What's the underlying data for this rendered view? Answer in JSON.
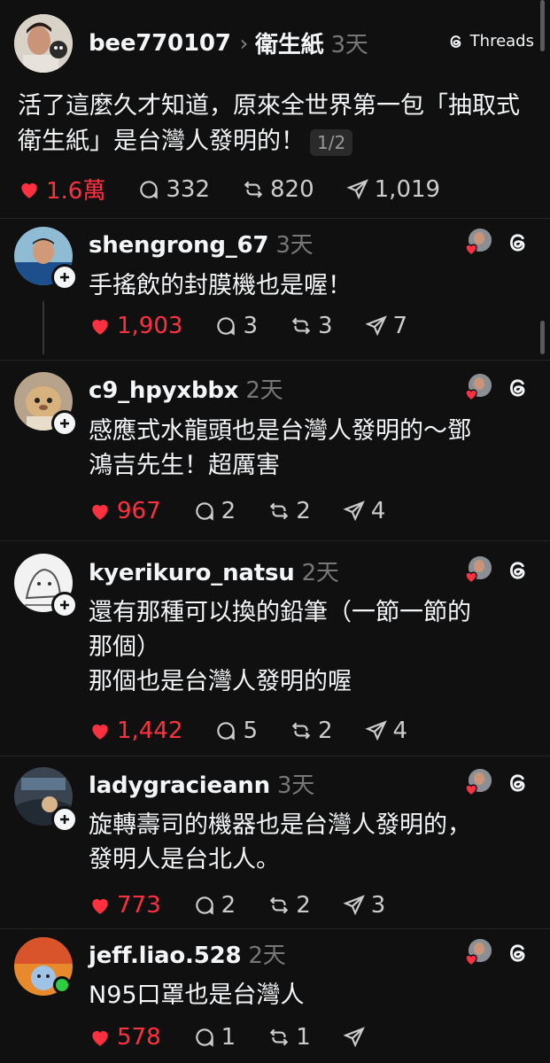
{
  "header": {
    "username": "bee770107",
    "separator": "›",
    "topic": "衛生紙",
    "time": "3天",
    "brand": "Threads",
    "post_text": "活了這麼久才知道，原來全世界第一包「抽取式衛生紙」是台灣人發明的！",
    "page_indicator": "1/2",
    "likes": "1.6萬",
    "comments": "332",
    "reposts": "820",
    "shares": "1,019"
  },
  "replies": [
    {
      "username": "shengrong_67",
      "time": "3天",
      "text": "手搖飲的封膜機也是喔！",
      "likes": "1,903",
      "comments": "3",
      "reposts": "3",
      "shares": "7"
    },
    {
      "username": "c9_hpyxbbx",
      "time": "2天",
      "text_lines": [
        "感應式水龍頭也是台灣人發明的～鄧",
        "鴻吉先生！超厲害"
      ],
      "likes": "967",
      "comments": "2",
      "reposts": "2",
      "shares": "4"
    },
    {
      "username": "kyerikuro_natsu",
      "time": "2天",
      "text_lines": [
        "還有那種可以換的鉛筆（一節一節的",
        "那個）",
        "那個也是台灣人發明的喔"
      ],
      "likes": "1,442",
      "comments": "5",
      "reposts": "2",
      "shares": "4"
    },
    {
      "username": "ladygracieann",
      "time": "3天",
      "text_lines": [
        "旋轉壽司的機器也是台灣人發明的，",
        "發明人是台北人。"
      ],
      "likes": "773",
      "comments": "2",
      "reposts": "2",
      "shares": "3"
    },
    {
      "username": "jeff.liao.528",
      "time": "2天",
      "text": "N95口罩也是台灣人",
      "likes": "578",
      "comments": "1",
      "reposts": "1",
      "shares": ""
    }
  ],
  "colors": {
    "background": "#101010",
    "like_red": "#ff3040",
    "muted": "#777777",
    "text": "#f3f5f7"
  },
  "icons": [
    "heart-icon",
    "comment-icon",
    "repost-icon",
    "share-icon",
    "threads-logo-icon",
    "plus-icon",
    "chevron-right-icon"
  ]
}
